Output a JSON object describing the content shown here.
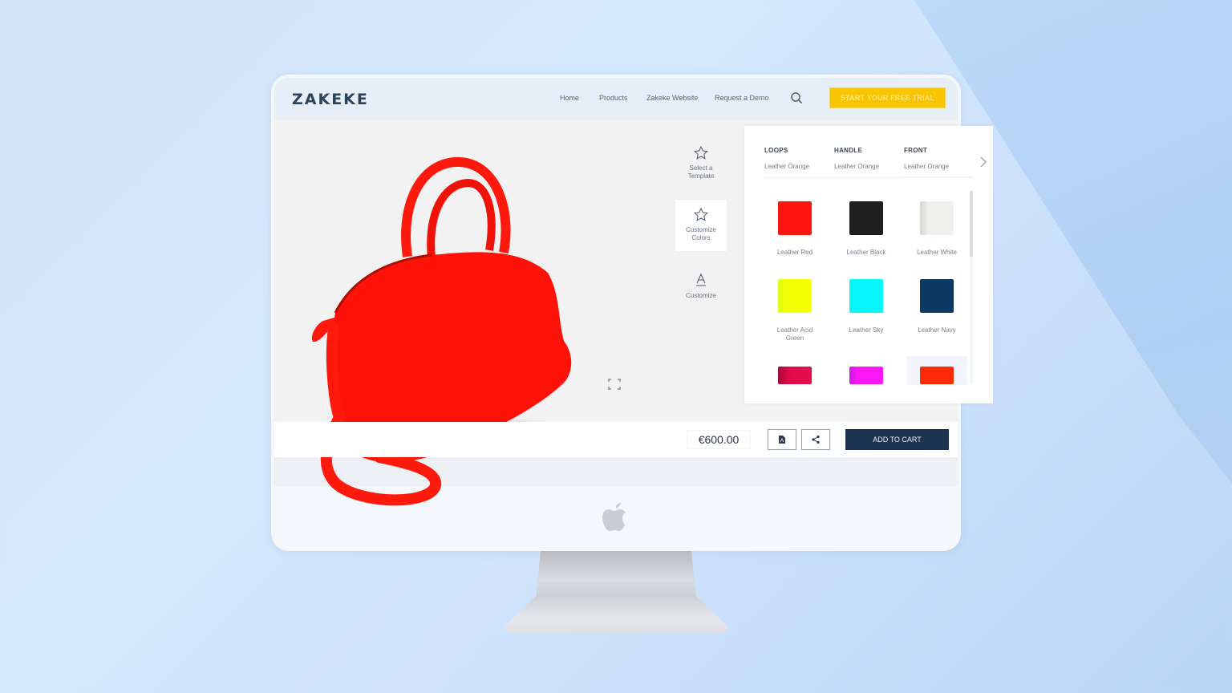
{
  "header": {
    "logo": "ZAKEKE",
    "nav": [
      {
        "label": "Home"
      },
      {
        "label": "Products"
      },
      {
        "label": "Zakeke Website"
      },
      {
        "label": "Request a Demo"
      }
    ],
    "search_icon": "search-icon",
    "cta_label": "START YOUR FREE TRIAL",
    "cta_color": "#f9c400"
  },
  "tools": [
    {
      "label": "Select a Template",
      "icon": "star-icon",
      "active": false
    },
    {
      "label": "Customize Colors",
      "icon": "star-icon",
      "active": true
    },
    {
      "label": "Customize",
      "icon": "text-a-icon",
      "active": false
    }
  ],
  "product": {
    "name": "handbag",
    "color": "#ff1a0d",
    "price": "€600.00",
    "pdf_icon": "pdf-icon",
    "share_icon": "share-icon",
    "add_to_cart": "ADD TO CART",
    "expand_icon": "fullscreen-icon"
  },
  "panel": {
    "components": [
      {
        "title": "LOOPS",
        "value": "Leather Orange"
      },
      {
        "title": "HANDLE",
        "value": "Leather Orange"
      },
      {
        "title": "FRONT",
        "value": "Leather Orange",
        "selected": true
      }
    ],
    "next_icon": "chevron-right-icon",
    "swatches": [
      {
        "label": "Leather Red",
        "color": "#ff1510"
      },
      {
        "label": "Leather Black",
        "color": "#1e1e1f"
      },
      {
        "label": "Leather White",
        "color": "#eeeeec"
      },
      {
        "label": "Leather Acid Green",
        "color": "#f2ff05"
      },
      {
        "label": "Leather Sky",
        "color": "#05f7fb"
      },
      {
        "label": "Leather Navy",
        "color": "#0c3a62"
      },
      {
        "label": "",
        "color": "#d80a45"
      },
      {
        "label": "",
        "color": "#ff16f5"
      },
      {
        "label": "",
        "color": "#ff2a06",
        "selected": true
      }
    ]
  }
}
